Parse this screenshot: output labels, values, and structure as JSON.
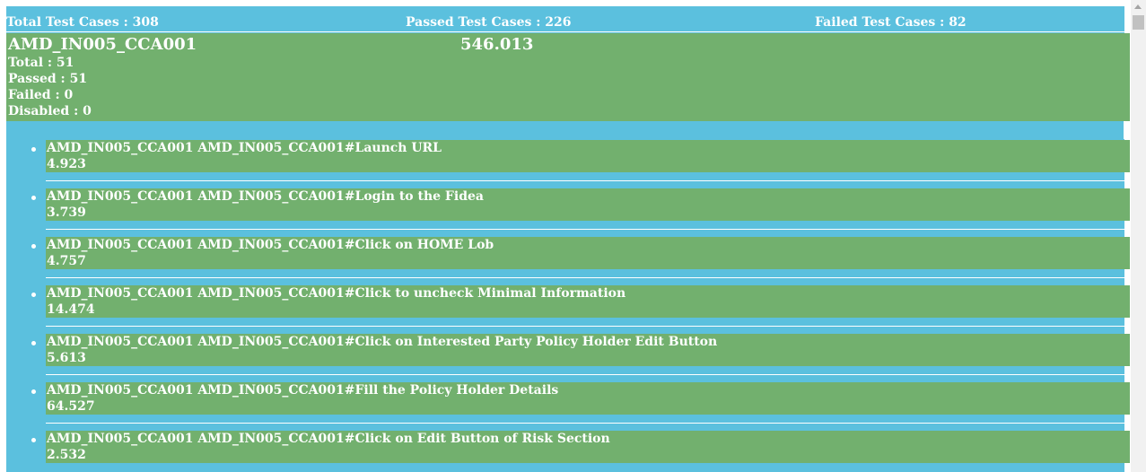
{
  "summary": {
    "total": "Total Test Cases : 308",
    "passed": "Passed Test Cases : 226",
    "failed": "Failed Test Cases : 82"
  },
  "suite": {
    "name": "AMD_IN005_CCA001",
    "duration": "546.013",
    "total": "Total : 51",
    "passed": "Passed : 51",
    "failed": "Failed : 0",
    "disabled": "Disabled : 0"
  },
  "tests": [
    {
      "name": "AMD_IN005_CCA001 AMD_IN005_CCA001#Launch URL",
      "duration": "4.923"
    },
    {
      "name": "AMD_IN005_CCA001 AMD_IN005_CCA001#Login to the Fidea",
      "duration": "3.739"
    },
    {
      "name": "AMD_IN005_CCA001 AMD_IN005_CCA001#Click on HOME Lob",
      "duration": "4.757"
    },
    {
      "name": "AMD_IN005_CCA001 AMD_IN005_CCA001#Click to uncheck Minimal Information",
      "duration": "14.474"
    },
    {
      "name": "AMD_IN005_CCA001 AMD_IN005_CCA001#Click on Interested Party Policy Holder Edit Button",
      "duration": "5.613"
    },
    {
      "name": "AMD_IN005_CCA001 AMD_IN005_CCA001#Fill the Policy Holder Details",
      "duration": "64.527"
    },
    {
      "name": "AMD_IN005_CCA001 AMD_IN005_CCA001#Click on Edit Button of Risk Section",
      "duration": "2.532"
    }
  ],
  "colors": {
    "background": "#5bc0de",
    "passed_block": "#72b06e",
    "text": "#ffffff"
  }
}
